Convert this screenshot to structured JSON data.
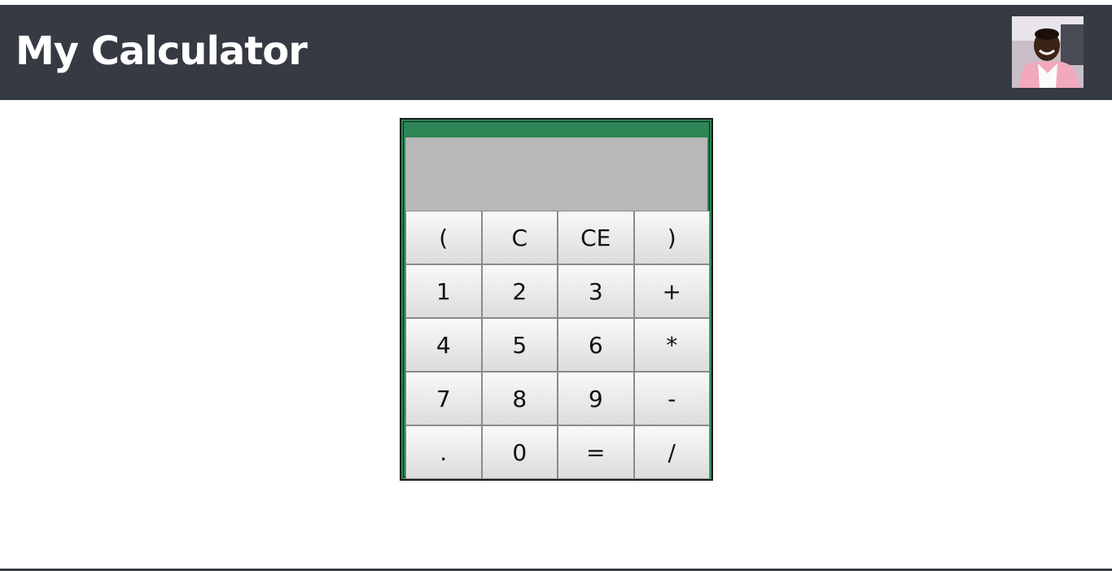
{
  "header": {
    "title": "My Calculator",
    "avatar_icon": "profile-photo",
    "background_color": "#363a42"
  },
  "calculator": {
    "display_value": "",
    "frame_color": "#2e8555",
    "display_color": "#b8b8b8",
    "keys": [
      [
        "(",
        "C",
        "CE",
        ")"
      ],
      [
        "1",
        "2",
        "3",
        "+"
      ],
      [
        "4",
        "5",
        "6",
        "*"
      ],
      [
        "7",
        "8",
        "9",
        "-"
      ],
      [
        ".",
        "0",
        "=",
        "/"
      ]
    ]
  }
}
